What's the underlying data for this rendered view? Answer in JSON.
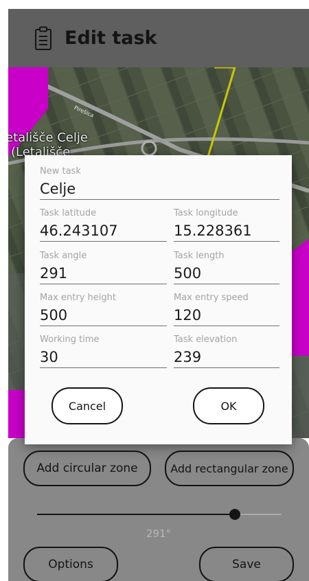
{
  "app_bar": {
    "icon": "clipboard-icon",
    "title": "Edit task"
  },
  "map": {
    "airfield_label_line1": "etališče Celje",
    "airfield_label_line2": "(Letališče",
    "road_label": "Pirešica",
    "colors": {
      "zone": "#c800c8",
      "track": "#c8c800"
    }
  },
  "dialog": {
    "task_name": {
      "label": "New task",
      "value": "Celje"
    },
    "fields": [
      {
        "label": "Task latitude",
        "value": "46.243107"
      },
      {
        "label": "Task longitude",
        "value": "15.228361"
      },
      {
        "label": "Task angle",
        "value": "291"
      },
      {
        "label": "Task length",
        "value": "500"
      },
      {
        "label": "Max entry height",
        "value": "500"
      },
      {
        "label": "Max entry speed",
        "value": "120"
      },
      {
        "label": "Working time",
        "value": "30"
      },
      {
        "label": "Task elevation",
        "value": "239"
      }
    ],
    "cancel_label": "Cancel",
    "ok_label": "OK"
  },
  "bottom_panel": {
    "add_circular_label": "Add circular zone",
    "add_rectangular_label": "Add rectangular zone",
    "slider": {
      "value": 291,
      "max": 360,
      "value_text": "291°"
    },
    "options_label": "Options",
    "save_label": "Save"
  }
}
